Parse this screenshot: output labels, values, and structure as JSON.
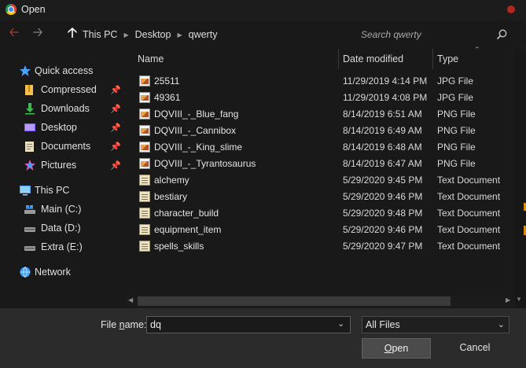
{
  "window": {
    "title": "Open",
    "app_icon": "chrome-icon"
  },
  "nav": {
    "back_icon": "arrow-left-icon",
    "forward_icon": "arrow-right-icon",
    "up_icon": "arrow-up-icon",
    "breadcrumb": [
      "This PC",
      "Desktop",
      "qwerty"
    ],
    "search_placeholder": "Search qwerty"
  },
  "sidebar": {
    "quick_access": "Quick access",
    "pinned": [
      {
        "label": "Compressed",
        "icon": "folder-icon"
      },
      {
        "label": "Downloads",
        "icon": "download-icon"
      },
      {
        "label": "Desktop",
        "icon": "desktop-icon"
      },
      {
        "label": "Documents",
        "icon": "documents-icon"
      },
      {
        "label": "Pictures",
        "icon": "pictures-icon"
      }
    ],
    "this_pc": "This PC",
    "drives": [
      {
        "label": "Main (C:)"
      },
      {
        "label": "Data (D:)"
      },
      {
        "label": "Extra (E:)"
      }
    ],
    "network": "Network"
  },
  "columns": {
    "name": "Name",
    "date": "Date modified",
    "type": "Type"
  },
  "files": [
    {
      "name": "25511",
      "date": "11/29/2019 4:14 PM",
      "type": "JPG File",
      "icon": "image"
    },
    {
      "name": "49361",
      "date": "11/29/2019 4:08 PM",
      "type": "JPG File",
      "icon": "image"
    },
    {
      "name": "DQVIII_-_Blue_fang",
      "date": "8/14/2019 6:51 AM",
      "type": "PNG File",
      "icon": "image"
    },
    {
      "name": "DQVIII_-_Cannibox",
      "date": "8/14/2019 6:49 AM",
      "type": "PNG File",
      "icon": "image"
    },
    {
      "name": "DQVIII_-_King_slime",
      "date": "8/14/2019 6:48 AM",
      "type": "PNG File",
      "icon": "image"
    },
    {
      "name": "DQVIII_-_Tyrantosaurus",
      "date": "8/14/2019 6:47 AM",
      "type": "PNG File",
      "icon": "image"
    },
    {
      "name": "alchemy",
      "date": "5/29/2020 9:45 PM",
      "type": "Text Document",
      "icon": "text"
    },
    {
      "name": "bestiary",
      "date": "5/29/2020 9:46 PM",
      "type": "Text Document",
      "icon": "text"
    },
    {
      "name": "character_build",
      "date": "5/29/2020 9:48 PM",
      "type": "Text Document",
      "icon": "text"
    },
    {
      "name": "equipment_item",
      "date": "5/29/2020 9:46 PM",
      "type": "Text Document",
      "icon": "text"
    },
    {
      "name": "spells_skills",
      "date": "5/29/2020 9:47 PM",
      "type": "Text Document",
      "icon": "text"
    }
  ],
  "footer": {
    "filename_label_pre": "File ",
    "filename_label_u": "n",
    "filename_label_post": "ame:",
    "filename_value": "dq",
    "filetype": "All Files",
    "open_label_u": "O",
    "open_label_rest": "pen",
    "cancel_label": "Cancel"
  },
  "colors": {
    "back_arrow": "#c8473d",
    "close": "#b3261e",
    "accent": "#d98c00"
  }
}
